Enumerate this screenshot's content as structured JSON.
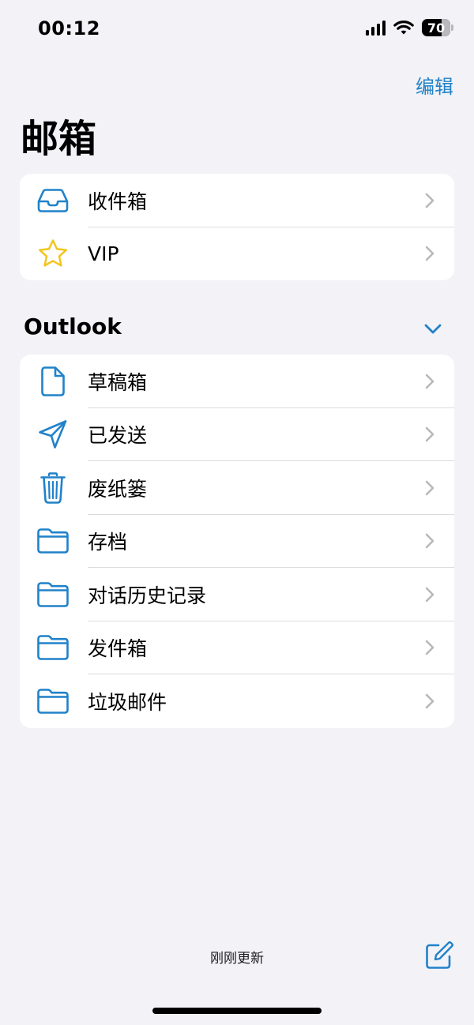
{
  "status_bar": {
    "time": "00:12",
    "battery_level": "70",
    "battery_fraction": 0.7
  },
  "nav": {
    "edit_label": "编辑",
    "title": "邮箱"
  },
  "mailboxes": [
    {
      "label": "收件箱",
      "icon": "inbox-tray-icon"
    },
    {
      "label": "VIP",
      "icon": "star-icon"
    }
  ],
  "account": {
    "name": "Outlook",
    "toggle_icon": "chevron-down-icon",
    "folders": [
      {
        "label": "草稿箱",
        "icon": "document-icon"
      },
      {
        "label": "已发送",
        "icon": "paper-plane-icon"
      },
      {
        "label": "废纸篓",
        "icon": "trash-icon"
      },
      {
        "label": "存档",
        "icon": "folder-icon"
      },
      {
        "label": "对话历史记录",
        "icon": "folder-icon"
      },
      {
        "label": "发件箱",
        "icon": "folder-icon"
      },
      {
        "label": "垃圾邮件",
        "icon": "folder-icon"
      }
    ]
  },
  "toolbar": {
    "status_text": "刚刚更新",
    "compose_icon": "compose-icon"
  },
  "colors": {
    "accent": "#2182c9",
    "background": "#f2f2f7",
    "card": "#ffffff",
    "star": "#f2c51c",
    "chevron": "#b8b8bd"
  }
}
